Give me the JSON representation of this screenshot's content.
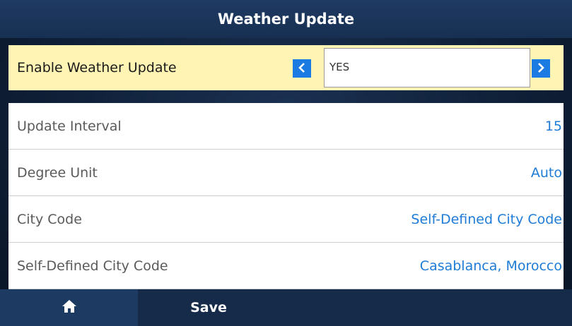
{
  "title": "Weather Update",
  "selected_setting": {
    "label": "Enable Weather Update",
    "value": "YES",
    "prev_icon": "chevron-left-icon",
    "next_icon": "chevron-right-icon"
  },
  "settings": [
    {
      "label": "Update Interval",
      "value": "15"
    },
    {
      "label": "Degree Unit",
      "value": "Auto"
    },
    {
      "label": "City Code",
      "value": "Self-Defined City Code"
    },
    {
      "label": "Self-Defined City Code",
      "value": "Casablanca, Morocco"
    }
  ],
  "bottom_bar": {
    "home_icon": "home-icon",
    "save_label": "Save"
  },
  "colors": {
    "accent": "#1b7be3",
    "value_text": "#1e7bd6",
    "highlight": "#fff4b3",
    "title_bar": "#1f3a63"
  }
}
